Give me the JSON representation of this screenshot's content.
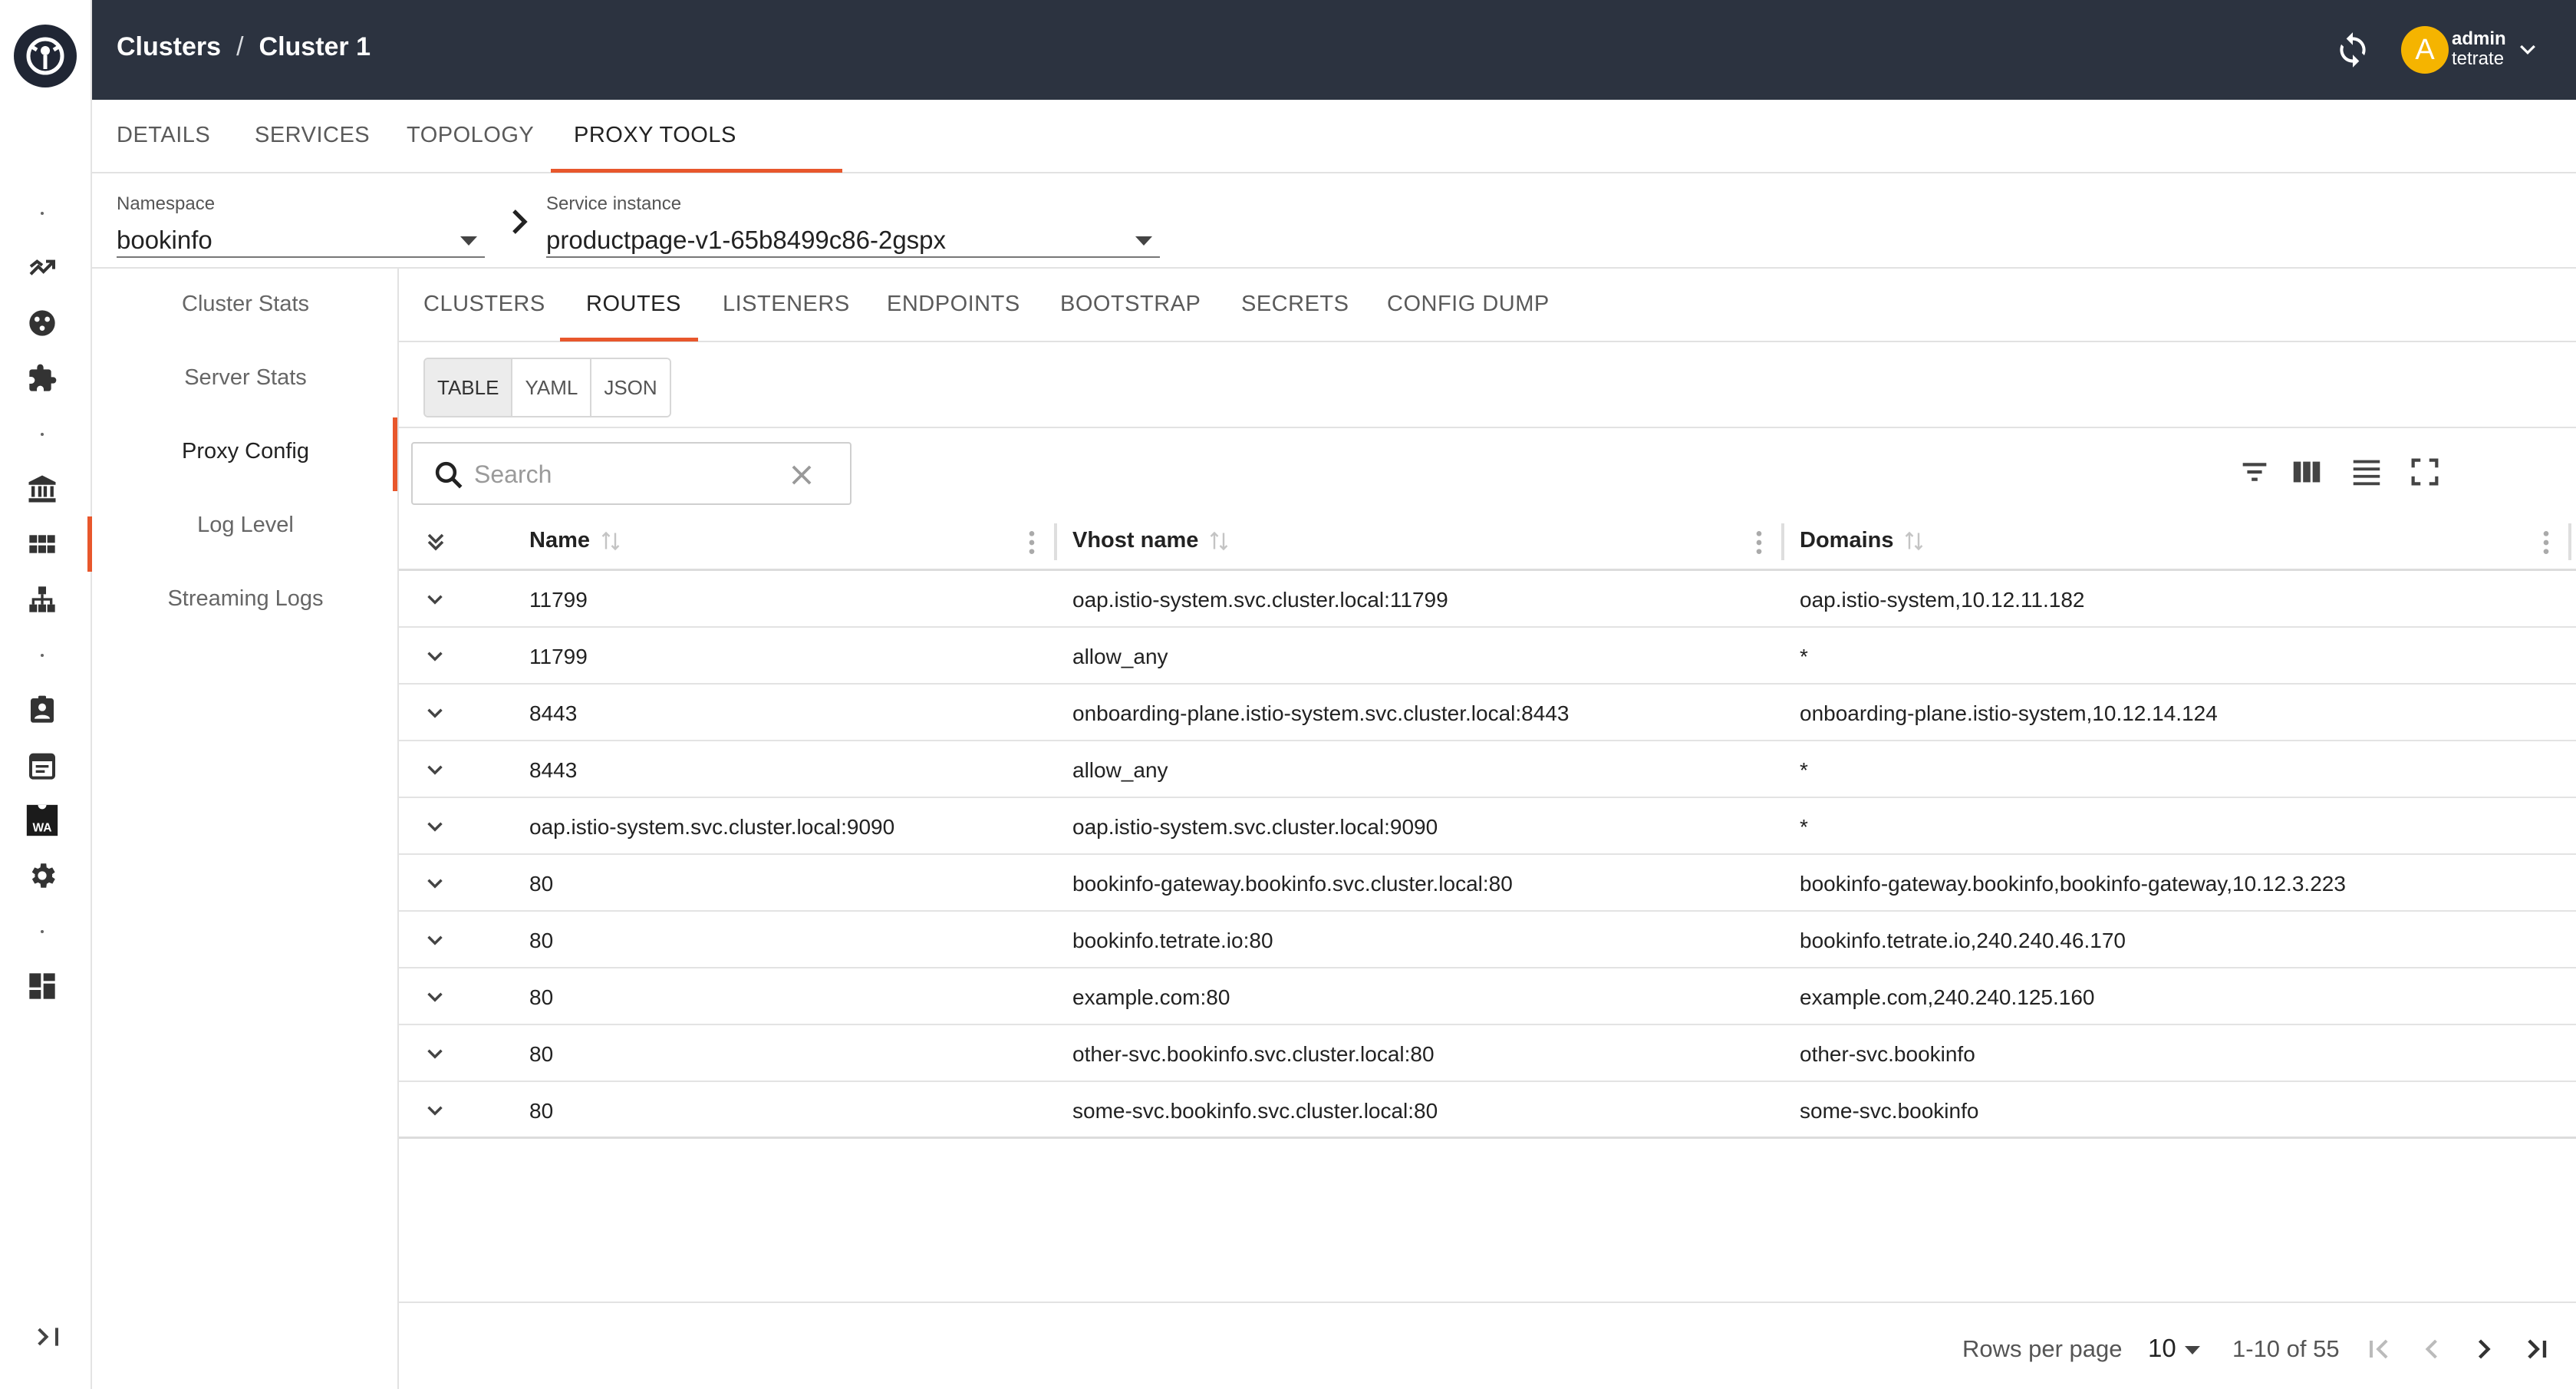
{
  "header": {
    "breadcrumb": [
      "Clusters",
      "Cluster 1"
    ],
    "breadcrumb_sep": "/",
    "user": {
      "initial": "A",
      "name": "admin",
      "org": "tetrate"
    }
  },
  "main_tabs": [
    {
      "label": "DETAILS",
      "active": false
    },
    {
      "label": "SERVICES",
      "active": false
    },
    {
      "label": "TOPOLOGY",
      "active": false
    },
    {
      "label": "PROXY TOOLS",
      "active": true
    }
  ],
  "selectors": {
    "namespace": {
      "label": "Namespace",
      "value": "bookinfo"
    },
    "service_instance": {
      "label": "Service instance",
      "value": "productpage-v1-65b8499c86-2gspx"
    }
  },
  "subnav": [
    {
      "label": "Cluster Stats",
      "active": false
    },
    {
      "label": "Server Stats",
      "active": false
    },
    {
      "label": "Proxy Config",
      "active": true
    },
    {
      "label": "Log Level",
      "active": false
    },
    {
      "label": "Streaming Logs",
      "active": false
    }
  ],
  "content_tabs": [
    {
      "label": "CLUSTERS",
      "active": false
    },
    {
      "label": "ROUTES",
      "active": true
    },
    {
      "label": "LISTENERS",
      "active": false
    },
    {
      "label": "ENDPOINTS",
      "active": false
    },
    {
      "label": "BOOTSTRAP",
      "active": false
    },
    {
      "label": "SECRETS",
      "active": false
    },
    {
      "label": "CONFIG DUMP",
      "active": false
    }
  ],
  "formats": [
    {
      "label": "TABLE",
      "active": true
    },
    {
      "label": "YAML",
      "active": false
    },
    {
      "label": "JSON",
      "active": false
    }
  ],
  "search": {
    "placeholder": "Search",
    "value": ""
  },
  "table": {
    "columns": [
      "Name",
      "Vhost name",
      "Domains"
    ],
    "rows": [
      [
        "11799",
        "oap.istio-system.svc.cluster.local:11799",
        "oap.istio-system,10.12.11.182"
      ],
      [
        "11799",
        "allow_any",
        "*"
      ],
      [
        "8443",
        "onboarding-plane.istio-system.svc.cluster.local:8443",
        "onboarding-plane.istio-system,10.12.14.124"
      ],
      [
        "8443",
        "allow_any",
        "*"
      ],
      [
        "oap.istio-system.svc.cluster.local:9090",
        "oap.istio-system.svc.cluster.local:9090",
        "*"
      ],
      [
        "80",
        "bookinfo-gateway.bookinfo.svc.cluster.local:80",
        "bookinfo-gateway.bookinfo,bookinfo-gateway,10.12.3.223"
      ],
      [
        "80",
        "bookinfo.tetrate.io:80",
        "bookinfo.tetrate.io,240.240.46.170"
      ],
      [
        "80",
        "example.com:80",
        "example.com,240.240.125.160"
      ],
      [
        "80",
        "other-svc.bookinfo.svc.cluster.local:80",
        "other-svc.bookinfo"
      ],
      [
        "80",
        "some-svc.bookinfo.svc.cluster.local:80",
        "some-svc.bookinfo"
      ]
    ]
  },
  "pagination": {
    "rows_per_page_label": "Rows per page",
    "rows_per_page": "10",
    "range": "1-10 of 55"
  },
  "colors": {
    "accent": "#e8572c",
    "header_bg": "#2c3340",
    "avatar": "#f5b400"
  },
  "icons": {
    "rail": [
      "topology-icon",
      "stats-icon",
      "extensions-icon",
      "organization-icon",
      "clusters-icon",
      "hierarchy-icon",
      "users-icon",
      "calendar-icon",
      "wasm-icon",
      "settings-icon",
      "dashboard-icon"
    ],
    "toolbar": [
      "filter-icon",
      "columns-icon",
      "density-icon",
      "fullscreen-icon"
    ]
  }
}
